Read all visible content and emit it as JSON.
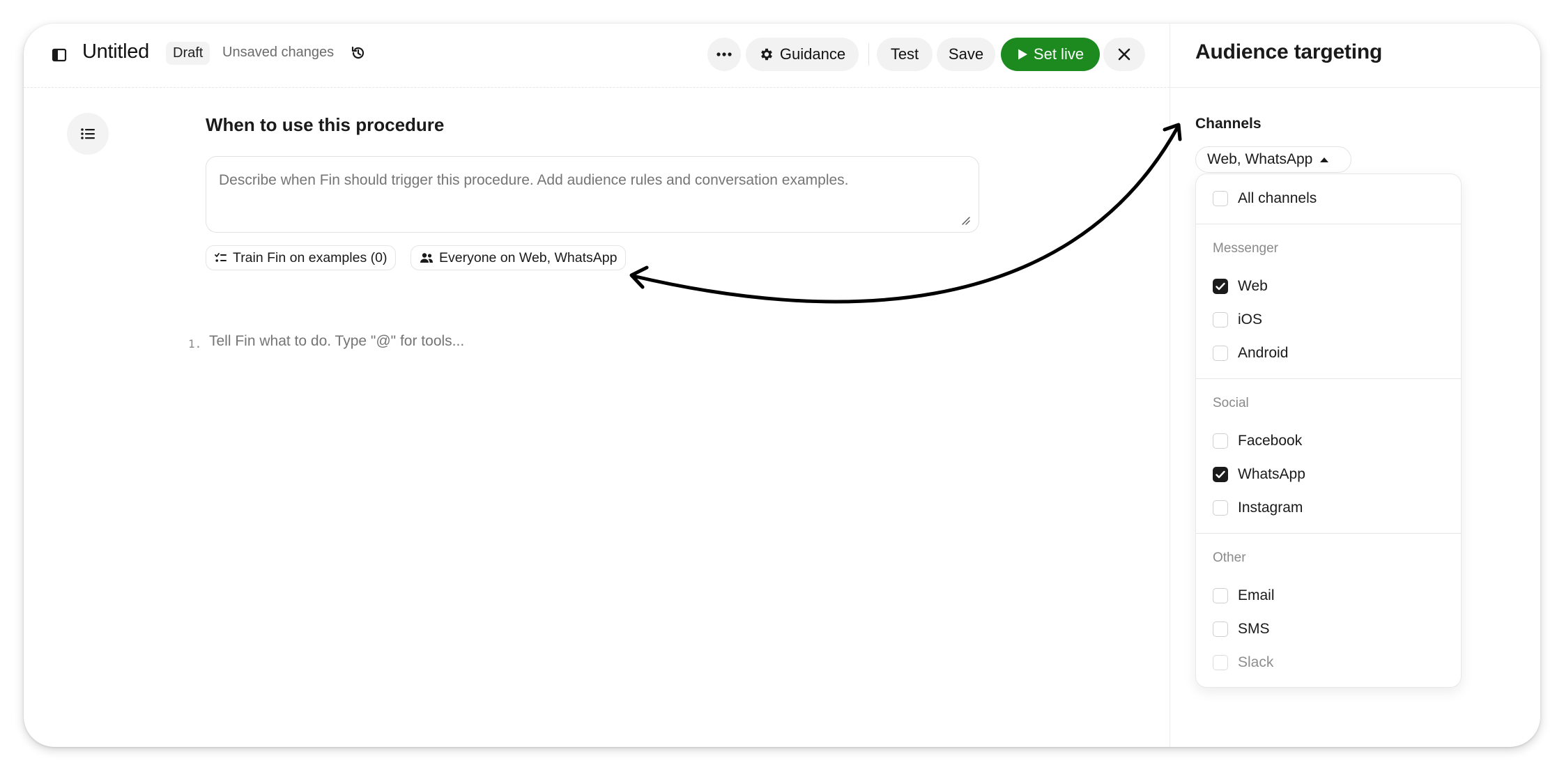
{
  "header": {
    "title": "Untitled",
    "status_badge": "Draft",
    "unsaved_text": "Unsaved changes",
    "guidance_label": "Guidance",
    "test_label": "Test",
    "save_label": "Save",
    "set_live_label": "Set live"
  },
  "editor": {
    "section_title": "When to use this procedure",
    "describe_placeholder": "Describe when Fin should trigger this procedure. Add audience rules and conversation examples.",
    "chips": {
      "train_label": "Train Fin on examples (0)",
      "audience_label": "Everyone on Web, WhatsApp"
    },
    "step": {
      "number": "1.",
      "placeholder": "Tell Fin what to do. Type \"@\" for tools..."
    }
  },
  "panel": {
    "title": "Audience targeting",
    "channels_label": "Channels",
    "selected_value": "Web, WhatsApp",
    "all_channels_label": "All channels",
    "groups": {
      "messenger": {
        "label": "Messenger",
        "options": [
          {
            "label": "Web",
            "checked": true
          },
          {
            "label": "iOS",
            "checked": false
          },
          {
            "label": "Android",
            "checked": false
          }
        ]
      },
      "social": {
        "label": "Social",
        "options": [
          {
            "label": "Facebook",
            "checked": false
          },
          {
            "label": "WhatsApp",
            "checked": true
          },
          {
            "label": "Instagram",
            "checked": false
          }
        ]
      },
      "other": {
        "label": "Other",
        "options": [
          {
            "label": "Email",
            "checked": false
          },
          {
            "label": "SMS",
            "checked": false
          },
          {
            "label": "Slack",
            "checked": false,
            "disabled": true
          }
        ]
      }
    }
  },
  "colors": {
    "accent_green": "#1c8a1f",
    "checkbox_checked": "#1a1a1a",
    "pill_background": "#f2f2f2"
  }
}
